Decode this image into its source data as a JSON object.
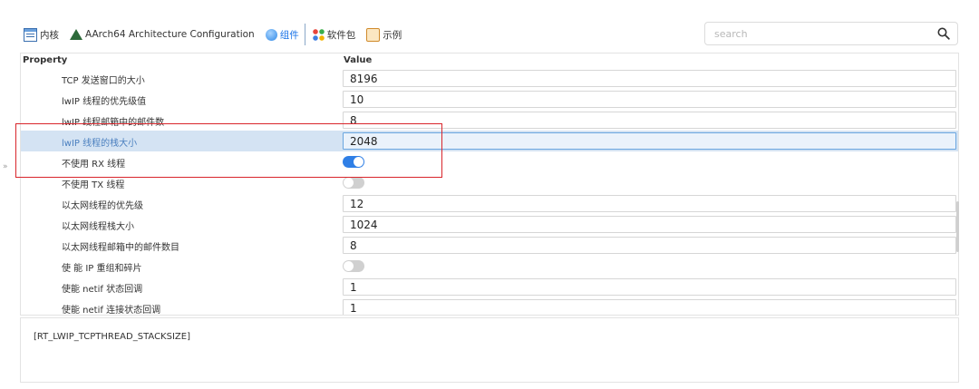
{
  "tabs": [
    {
      "label": "内核",
      "icon": "kernel-grid-icon"
    },
    {
      "label": "AArch64 Architecture Configuration",
      "icon": "arch-icon"
    },
    {
      "label": "组件",
      "icon": "component-icon",
      "active": true
    },
    {
      "label": "软件包",
      "icon": "package-icon"
    },
    {
      "label": "示例",
      "icon": "example-icon"
    }
  ],
  "search": {
    "placeholder": "search",
    "value": ""
  },
  "grid": {
    "header_property": "Property",
    "header_value": "Value",
    "rows": [
      {
        "label": "TCP 发送窗口的大小",
        "type": "text",
        "value": "8196"
      },
      {
        "label": "lwIP 线程的优先级值",
        "type": "text",
        "value": "10"
      },
      {
        "label": "lwIP 线程邮箱中的邮件数",
        "type": "text",
        "value": "8"
      },
      {
        "label": "lwIP 线程的栈大小",
        "type": "text",
        "value": "2048",
        "selected": true
      },
      {
        "label": "不使用 RX 线程",
        "type": "toggle",
        "on": true
      },
      {
        "label": "不使用 TX 线程",
        "type": "toggle",
        "on": false
      },
      {
        "label": "以太网线程的优先级",
        "type": "text",
        "value": "12"
      },
      {
        "label": "以太网线程栈大小",
        "type": "text",
        "value": "1024"
      },
      {
        "label": "以太网线程邮箱中的邮件数目",
        "type": "text",
        "value": "8"
      },
      {
        "label": "使 能 IP 重组和碎片",
        "type": "toggle",
        "on": false
      },
      {
        "label": "使能 netif 状态回调",
        "type": "text",
        "value": "1"
      },
      {
        "label": "使能 netif 连接状态回调",
        "type": "text",
        "value": "1"
      }
    ]
  },
  "description": {
    "text": "[RT_LWIP_TCPTHREAD_STACKSIZE]"
  },
  "colors": {
    "accent": "#2f7fe6",
    "highlight": "#d9252b",
    "selected_row": "#d4e3f3"
  }
}
